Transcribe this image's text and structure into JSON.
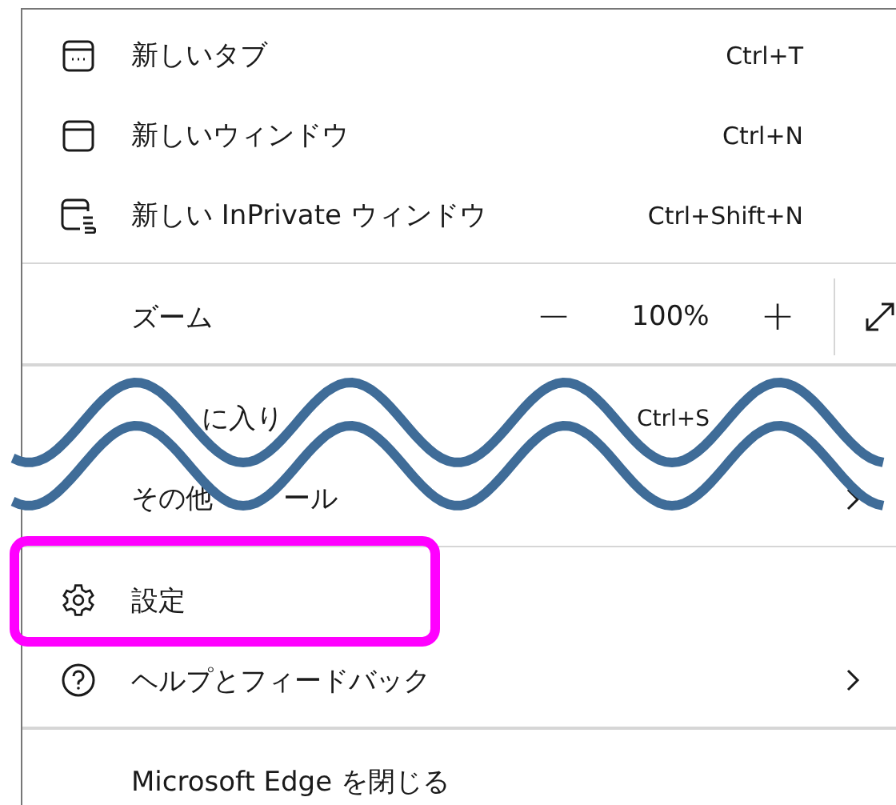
{
  "menu": {
    "items": [
      {
        "kind": "item",
        "label": "新しいタブ",
        "shortcut": "Ctrl+T",
        "submenu": false,
        "highlighted": false,
        "divider_after": false
      },
      {
        "kind": "item",
        "label": "新しいウィンドウ",
        "shortcut": "Ctrl+N",
        "submenu": false,
        "highlighted": false,
        "divider_after": false
      },
      {
        "kind": "item",
        "label": "新しい InPrivate ウィンドウ",
        "shortcut": "Ctrl+Shift+N",
        "submenu": false,
        "highlighted": false,
        "divider_after": true
      },
      {
        "kind": "zoom",
        "label": "ズーム",
        "minus": "−",
        "value": "100%",
        "plus": "+",
        "divider_after": true
      },
      {
        "kind": "cut",
        "segments": [
          {
            "kind": "gap"
          },
          {
            "kind": "text",
            "text": "に入り"
          }
        ],
        "shortcut": "Ctrl+S",
        "submenu": false,
        "divider_after": false
      },
      {
        "kind": "cut",
        "segments": [
          {
            "kind": "text",
            "text": "その他"
          },
          {
            "kind": "gap"
          },
          {
            "kind": "text",
            "text": "ール"
          }
        ],
        "submenu": true,
        "divider_after": true
      },
      {
        "kind": "item",
        "label": "設定",
        "submenu": false,
        "highlighted": true,
        "divider_after": false
      },
      {
        "kind": "item",
        "label": "ヘルプとフィードバック",
        "submenu": true,
        "highlighted": false,
        "divider_after": true
      },
      {
        "kind": "item",
        "label": "Microsoft Edge を閉じる",
        "submenu": false,
        "highlighted": false,
        "divider_after": false
      }
    ]
  }
}
